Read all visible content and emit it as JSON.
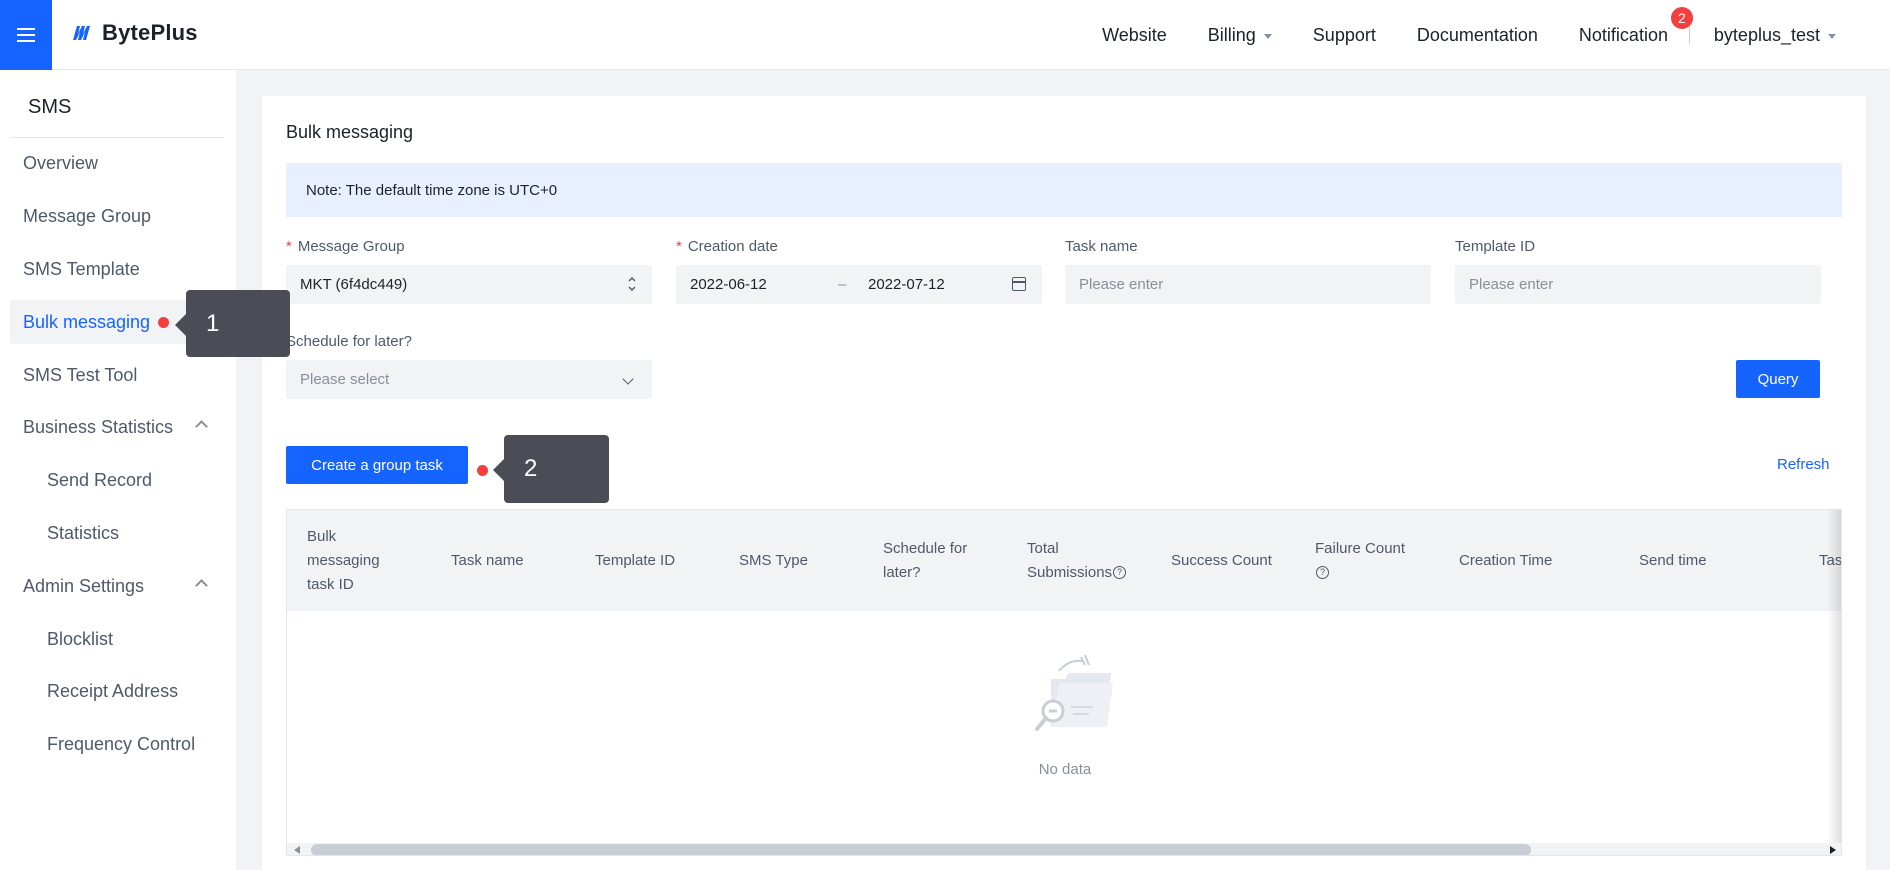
{
  "header": {
    "brand": "BytePlus",
    "nav": {
      "website": "Website",
      "billing": "Billing",
      "support": "Support",
      "documentation": "Documentation",
      "notifications": "Notification",
      "notification_count": "2",
      "user": "byteplus_test"
    }
  },
  "sidebar": {
    "title": "SMS",
    "items": [
      {
        "label": "Overview"
      },
      {
        "label": "Message Group"
      },
      {
        "label": "SMS Template"
      },
      {
        "label": "Bulk messaging"
      },
      {
        "label": "SMS Test Tool"
      },
      {
        "label": "Business Statistics"
      },
      {
        "label": "Send Record"
      },
      {
        "label": "Statistics"
      },
      {
        "label": "Admin Settings"
      },
      {
        "label": "Blocklist"
      },
      {
        "label": "Receipt Address"
      },
      {
        "label": "Frequency Control"
      }
    ]
  },
  "page": {
    "title": "Bulk messaging",
    "note": "Note: The default time zone is UTC+0"
  },
  "filters": {
    "message_group_label": "Message Group",
    "message_group_value": "MKT (6f4dc449)",
    "creation_date_label": "Creation date",
    "date_start": "2022-06-12",
    "date_separator": "–",
    "date_end": "2022-07-12",
    "task_name_label": "Task name",
    "task_name_placeholder": "Please enter",
    "template_id_label": "Template ID",
    "template_id_placeholder": "Please enter",
    "schedule_label": "Schedule for later?",
    "schedule_placeholder": "Please select",
    "query_label": "Query"
  },
  "actions": {
    "create_label": "Create a group task",
    "refresh_label": "Refresh"
  },
  "table": {
    "columns": [
      {
        "label": "Bulk messaging task ID"
      },
      {
        "label": "Task name"
      },
      {
        "label": "Template ID"
      },
      {
        "label": "SMS Type"
      },
      {
        "label": "Schedule for later?"
      },
      {
        "label": "Total Submissions"
      },
      {
        "label": "Success Count"
      },
      {
        "label": "Failure Count"
      },
      {
        "label": "Creation Time"
      },
      {
        "label": "Send time"
      },
      {
        "label": "Tas"
      }
    ],
    "empty_text": "No data"
  },
  "callouts": {
    "one": "1",
    "two": "2"
  },
  "colors": {
    "primary": "#1664ff",
    "badge": "#f53f3f",
    "callout": "#4a4d56"
  }
}
